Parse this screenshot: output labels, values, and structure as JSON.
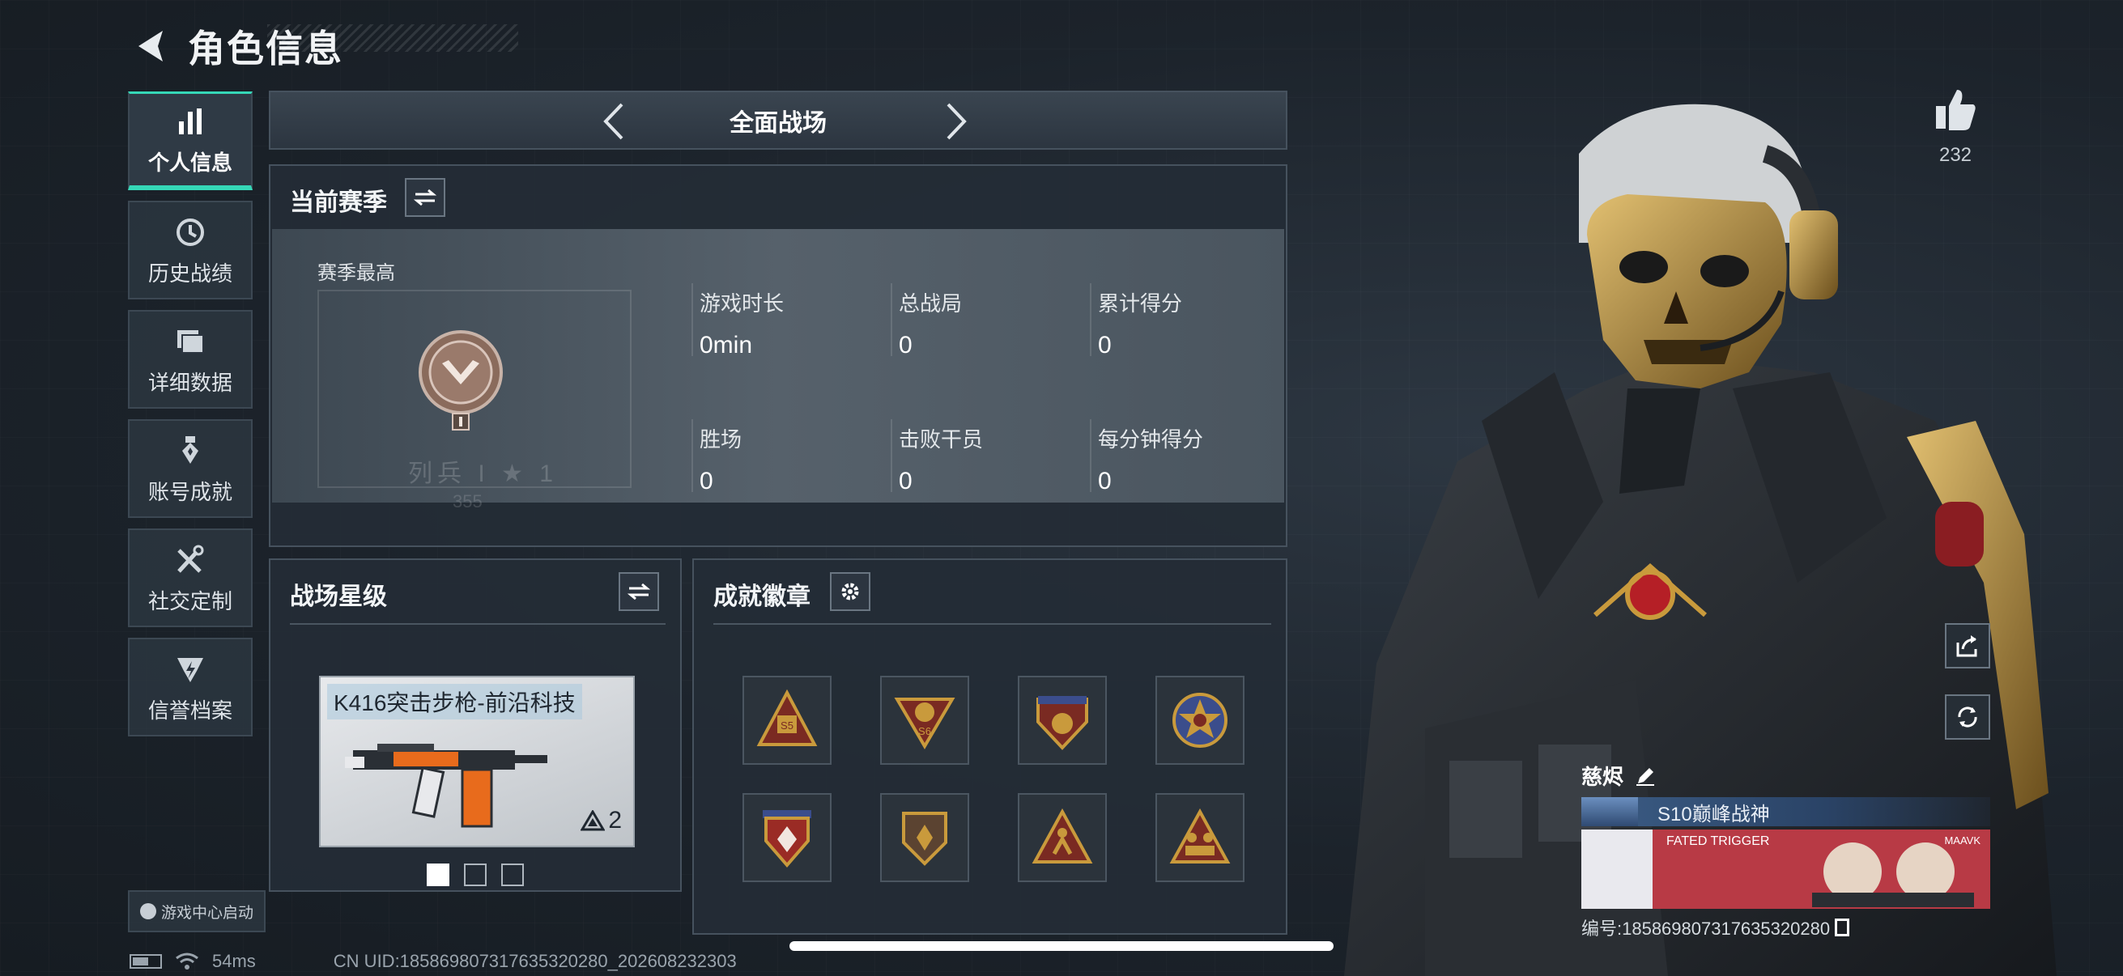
{
  "header": {
    "title": "角色信息"
  },
  "nav": {
    "items": [
      {
        "label": "个人信息",
        "icon": "bar-chart-icon",
        "active": true
      },
      {
        "label": "历史战绩",
        "icon": "history-icon",
        "active": false
      },
      {
        "label": "详细数据",
        "icon": "folder-icon",
        "active": false
      },
      {
        "label": "账号成就",
        "icon": "medal-icon",
        "active": false
      },
      {
        "label": "社交定制",
        "icon": "tools-icon",
        "active": false
      },
      {
        "label": "信誉档案",
        "icon": "shield-bolt-icon",
        "active": false
      }
    ],
    "game_center": "游戏中心启动"
  },
  "mode": {
    "title": "全面战场"
  },
  "season": {
    "title": "当前赛季",
    "best_label": "赛季最高",
    "rank_text": "列兵 I ★ 1",
    "rank_sub": "355",
    "stats": [
      {
        "label": "游戏时长",
        "value": "0min"
      },
      {
        "label": "总战局",
        "value": "0"
      },
      {
        "label": "累计得分",
        "value": "0"
      },
      {
        "label": "胜场",
        "value": "0"
      },
      {
        "label": "击败干员",
        "value": "0"
      },
      {
        "label": "每分钟得分",
        "value": "0"
      }
    ]
  },
  "starlevel": {
    "title": "战场星级",
    "weapon_name": "K416突击步枪-前沿科技",
    "weapon_stars": "2",
    "pages": 3,
    "current_page": 1
  },
  "badges": {
    "title": "成就徽章",
    "items": [
      {
        "icon": "badge-s5-icon",
        "text": "S5"
      },
      {
        "icon": "badge-s6-icon",
        "text": "S6"
      },
      {
        "icon": "badge-crest-stars-icon",
        "text": ""
      },
      {
        "icon": "badge-star-ring-icon",
        "text": ""
      },
      {
        "icon": "badge-red-diamond-icon",
        "text": ""
      },
      {
        "icon": "badge-shield-icon",
        "text": ""
      },
      {
        "icon": "badge-runner-icon",
        "text": ""
      },
      {
        "icon": "badge-team-icon",
        "text": ""
      }
    ]
  },
  "profile": {
    "likes": "232",
    "name": "慈烬",
    "title": "S10巅峰战神",
    "namecard_tag": "FATED TRIGGER",
    "namecard_brand": "MAAVK",
    "uid_label": "编号:1858698073176353202​80"
  },
  "status": {
    "ping": "54ms",
    "uid_footer": "CN UID:1858698073176353202​80_202608232303"
  },
  "colors": {
    "accent": "#35d7b7",
    "panel": "#242d36",
    "gold": "#c99a3c"
  }
}
